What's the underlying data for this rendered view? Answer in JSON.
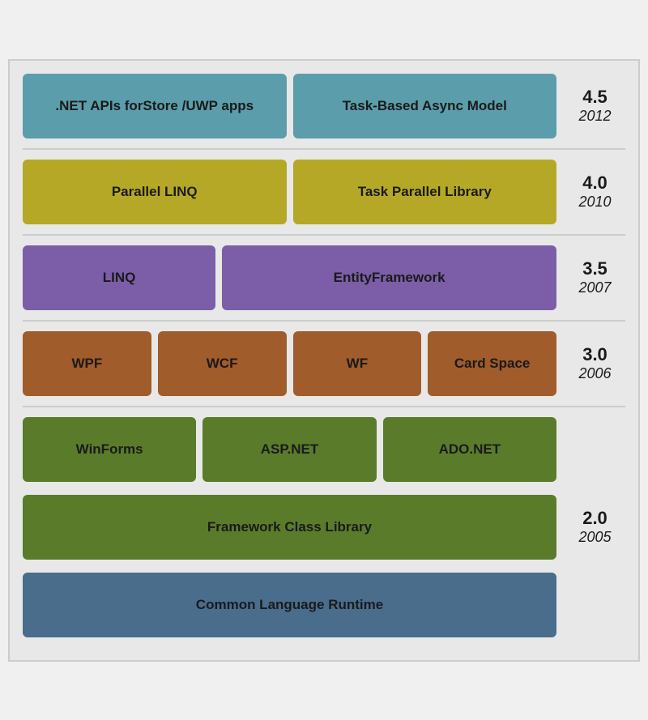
{
  "rows": [
    {
      "id": "row-4-5",
      "version": "4.5",
      "year": "2012",
      "colorClass": "teal",
      "blocks": [
        {
          "label": ".NET APIs forStore /UWP apps"
        },
        {
          "label": "Task-Based Async Model"
        }
      ],
      "layout": "two-equal"
    },
    {
      "id": "row-4-0",
      "version": "4.0",
      "year": "2010",
      "colorClass": "olive",
      "blocks": [
        {
          "label": "Parallel LINQ"
        },
        {
          "label": "Task Parallel Library"
        }
      ],
      "layout": "two-equal"
    },
    {
      "id": "row-3-5",
      "version": "3.5",
      "year": "2007",
      "colorClass": "purple",
      "blocks": [
        {
          "label": "LINQ"
        },
        {
          "label": "EntityFramework"
        }
      ],
      "layout": "two-equal"
    },
    {
      "id": "row-3-0",
      "version": "3.0",
      "year": "2006",
      "colorClass": "brown",
      "blocks": [
        {
          "label": "WPF"
        },
        {
          "label": "WCF"
        },
        {
          "label": "WF"
        },
        {
          "label": "Card Space"
        }
      ],
      "layout": "four-equal"
    },
    {
      "id": "row-2-0",
      "version": "2.0",
      "year": "2005",
      "colorClass": "green",
      "topBlocks": [
        {
          "label": "WinForms"
        },
        {
          "label": "ASP.NET"
        },
        {
          "label": "ADO.NET"
        }
      ],
      "bottomBlock": "Framework Class Library",
      "bottomBlock2": "Common Language Runtime",
      "layout": "two-0"
    }
  ]
}
